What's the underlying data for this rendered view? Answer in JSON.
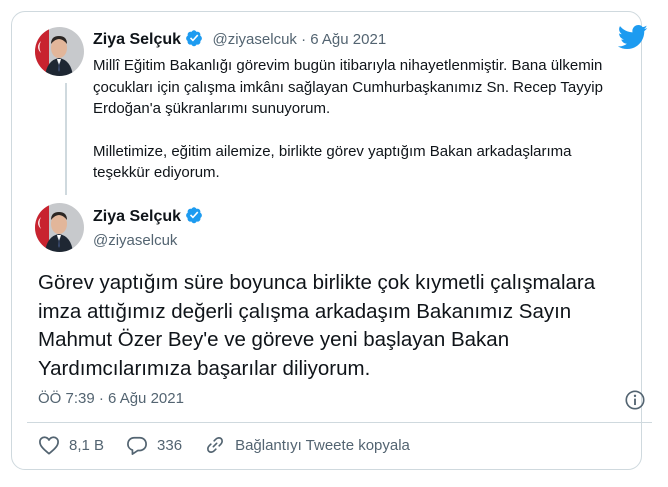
{
  "tweet1": {
    "author_name": "Ziya Selçuk",
    "handle_date": "@ziyaselcuk · 6 Ağu 2021",
    "paragraph1": "Millî Eğitim Bakanlığı görevim bugün itibarıyla nihayetlenmiştir. Bana ülkemin çocukları için çalışma imkânı sağlayan Cumhurbaşkanımız Sn. Recep Tayyip Erdoğan'a şükranlarımı sunuyorum.",
    "paragraph2": "Milletimize, eğitim ailemize, birlikte görev yaptığım Bakan arkadaşlarıma teşekkür ediyorum."
  },
  "tweet2": {
    "author_name": "Ziya Selçuk",
    "handle": "@ziyaselcuk",
    "text": "Görev yaptığım süre boyunca birlikte çok kıymetli çalışmalara imza attığımız değerli çalışma arkadaşım Bakanımız Sayın Mahmut Özer Bey'e ve göreve yeni başlayan Bakan Yardımcılarımıza  başarılar diliyorum.",
    "timestamp": "ÖÖ 7:39 · 6 Ağu 2021"
  },
  "actions": {
    "likes": "8,1 B",
    "replies": "336",
    "copy_link": "Bağlantıyı Tweete kopyala"
  },
  "icons": {
    "brand": "twitter-bird-icon",
    "verified": "verified-badge-icon",
    "info": "info-icon",
    "like": "heart-icon",
    "reply": "reply-icon",
    "link": "link-icon"
  },
  "colors": {
    "twitter_blue": "#1d9bf0",
    "text": "#0f1419",
    "secondary": "#536471",
    "border": "#cfd9de"
  }
}
